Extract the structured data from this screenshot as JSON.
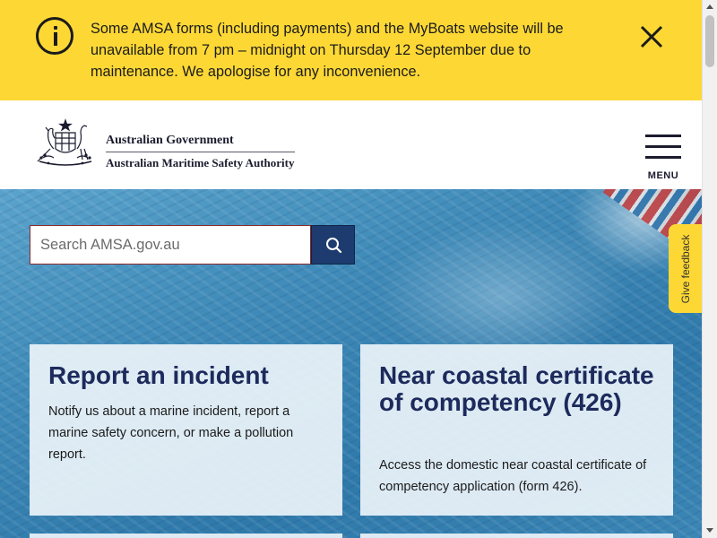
{
  "alert": {
    "message": "Some AMSA forms (including payments) and the MyBoats website will be unavailable from 7 pm – midnight on Thursday 12 September due to maintenance. We apologise for any inconvenience.",
    "icon": "info-icon",
    "close_icon": "close-icon",
    "background": "#fdd835"
  },
  "header": {
    "logo": {
      "line1": "Australian Government",
      "line2": "Australian Maritime Safety Authority",
      "crest_icon": "coat-of-arms-icon"
    },
    "menu_label": "MENU",
    "menu_icon": "hamburger-icon"
  },
  "search": {
    "placeholder": "Search AMSA.gov.au",
    "button_icon": "search-icon",
    "button_color": "#1d3b6e"
  },
  "feedback": {
    "label": "Give feedback"
  },
  "cards": [
    {
      "title": "Report an incident",
      "description": "Notify us about a marine incident, report a marine safety concern, or make a pollution report."
    },
    {
      "title": "Near coastal certificate of competency (426)",
      "description": "Access the domestic near coastal certificate of competency application (form 426)."
    }
  ],
  "colors": {
    "brand_navy": "#1d2a5c",
    "alert_yellow": "#fdd835"
  }
}
